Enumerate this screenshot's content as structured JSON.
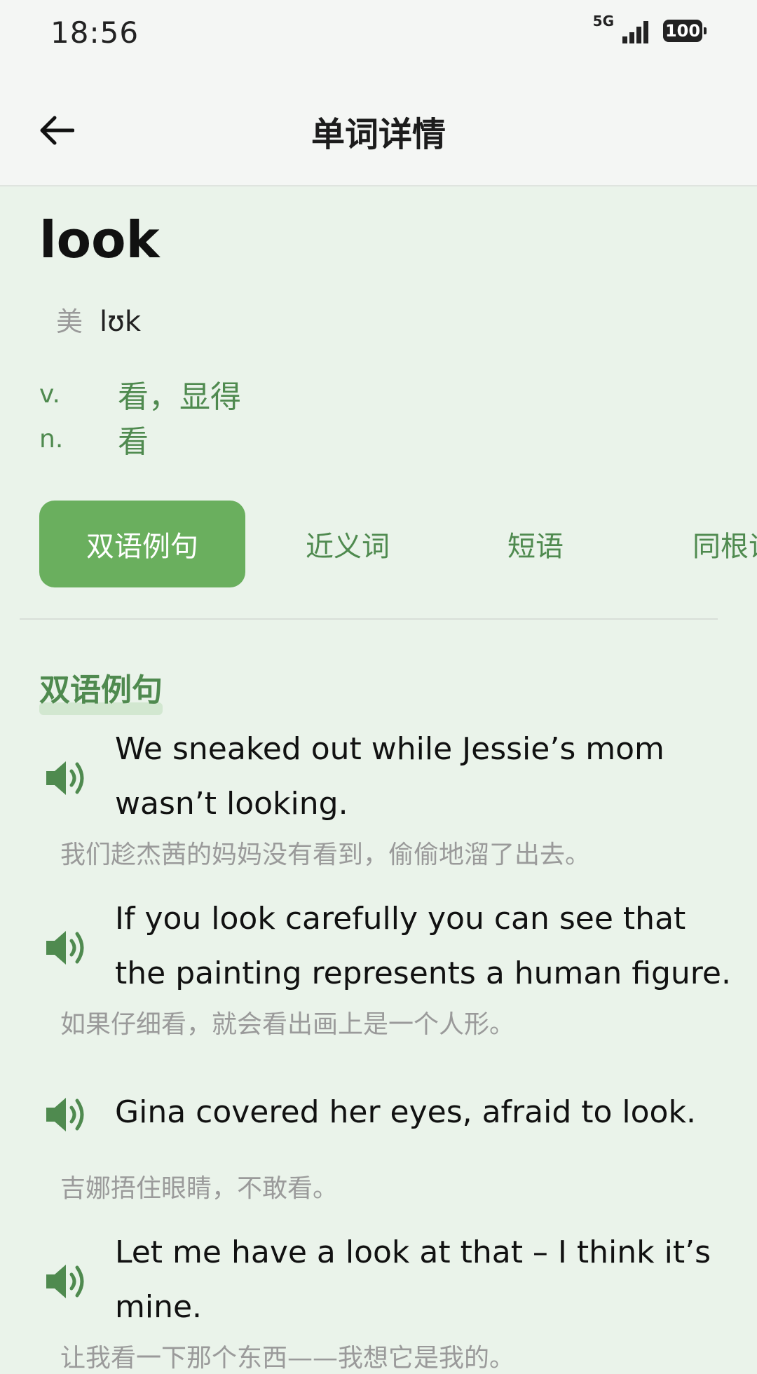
{
  "status_bar": {
    "time": "18:56",
    "network": "5G",
    "battery": "100"
  },
  "app_bar": {
    "title": "单词详情"
  },
  "word": {
    "text": "look",
    "phonetic_region": "美",
    "phonetic": "lʊk",
    "definitions": [
      {
        "pos": "v.",
        "meaning": "看，显得"
      },
      {
        "pos": "n.",
        "meaning": "看"
      }
    ]
  },
  "tabs": [
    {
      "label": "双语例句",
      "active": true
    },
    {
      "label": "近义词",
      "active": false
    },
    {
      "label": "短语",
      "active": false
    },
    {
      "label": "同根词",
      "active": false
    }
  ],
  "section": {
    "title": "双语例句"
  },
  "examples": [
    {
      "en": "We sneaked out while Jessie’s mom wasn’t looking.",
      "zh": "我们趁杰茜的妈妈没有看到，偷偷地溜了出去。"
    },
    {
      "en": "If you look carefully you can see that the painting represents a human figure.",
      "zh": "如果仔细看，就会看出画上是一个人形。"
    },
    {
      "en": "Gina covered her eyes, afraid to look.",
      "zh": "吉娜捂住眼睛，不敢看。"
    },
    {
      "en": "Let me have a look at that – I think it’s mine.",
      "zh": "让我看一下那个东西——我想它是我的。"
    }
  ],
  "colors": {
    "accent": "#6aaf5e",
    "accent_text": "#4f8a4f",
    "background": "#eaf3ea"
  }
}
